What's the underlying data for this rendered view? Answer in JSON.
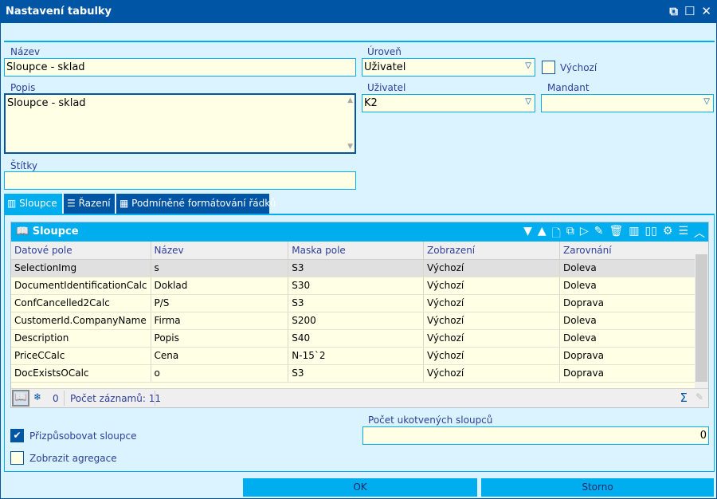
{
  "window": {
    "title": "Nastavení tabulky",
    "controls": [
      "⧉",
      "☐",
      "✕"
    ]
  },
  "form": {
    "name_label": "Název",
    "name_value": "Sloupce - sklad",
    "level_label": "Úroveň",
    "level_value": "Uživatel",
    "default_label": "Výchozí",
    "default_checked": false,
    "desc_label": "Popis",
    "desc_value": "Sloupce - sklad",
    "user_label": "Uživatel",
    "user_value": "K2",
    "mandant_label": "Mandant",
    "mandant_value": "",
    "tags_label": "Štítky",
    "tags_value": ""
  },
  "tabs": [
    {
      "label": "Sloupce",
      "icon": "columns-icon",
      "active": true
    },
    {
      "label": "Řazení",
      "icon": "lines-icon"
    },
    {
      "label": "Podmíněné formátování řádků",
      "icon": "table-icon"
    }
  ],
  "grid": {
    "title": "Sloupce",
    "columns": [
      "Datové pole",
      "Název",
      "Maska pole",
      "Zobrazení",
      "Zarovnání"
    ],
    "rows": [
      [
        "SelectionImg",
        "s",
        "S3",
        "Výchozí",
        "Doleva"
      ],
      [
        "DocumentIdentificationCalc",
        "Doklad",
        "S30",
        "Výchozí",
        "Doleva"
      ],
      [
        "ConfCancelled2Calc",
        "P/S",
        "S3",
        "Výchozí",
        "Doprava"
      ],
      [
        "CustomerId.CompanyName",
        "Firma",
        "S200",
        "Výchozí",
        "Doleva"
      ],
      [
        "Description",
        "Popis",
        "S40",
        "Výchozí",
        "Doleva"
      ],
      [
        "PriceCCalc",
        "Cena",
        "N-15`2",
        "Výchozí",
        "Doprava"
      ],
      [
        "DocExistsOCalc",
        "o",
        "S3",
        "Výchozí",
        "Doprava"
      ]
    ],
    "frozen_count": "0",
    "record_count": "Počet záznamů: 11",
    "sum_icon": "Σ"
  },
  "options": {
    "fit_columns_label": "Přizpůsobovat sloupce",
    "fit_columns_checked": true,
    "show_agg_label": "Zobrazit agregace",
    "show_agg_checked": false,
    "anchored_label": "Počet ukotvených sloupců",
    "anchored_value": "0"
  },
  "buttons": {
    "ok": "OK",
    "cancel": "Storno"
  },
  "colors": {
    "titlebar": "#0055a5",
    "accent": "#00aeef",
    "background": "#dbf3fe",
    "input": "#ffffe6"
  }
}
